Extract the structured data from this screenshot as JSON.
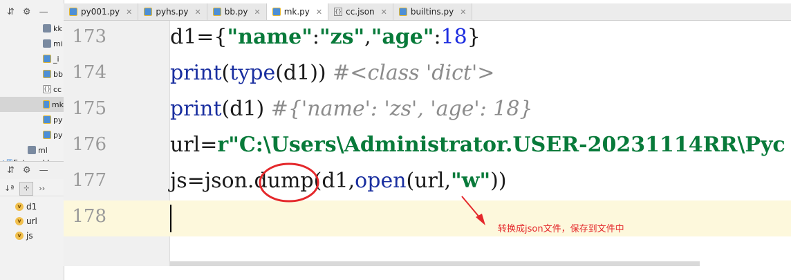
{
  "project_tree": {
    "items": [
      {
        "label": "kk",
        "icon": "folder-icon",
        "selected": false
      },
      {
        "label": "mi",
        "icon": "folder-icon",
        "selected": false
      },
      {
        "label": "_i",
        "icon": "python-file-icon",
        "selected": false
      },
      {
        "label": "bb",
        "icon": "python-file-icon",
        "selected": false
      },
      {
        "label": "cc",
        "icon": "json-file-icon",
        "selected": false
      },
      {
        "label": "mk",
        "icon": "python-file-icon",
        "selected": true
      },
      {
        "label": "py",
        "icon": "python-file-icon",
        "selected": false
      },
      {
        "label": "py",
        "icon": "python-file-icon",
        "selected": false
      },
      {
        "label": "ml",
        "icon": "folder-icon",
        "selected": false
      },
      {
        "label": "External L",
        "icon": "library-icon",
        "selected": false
      }
    ]
  },
  "structure": {
    "items": [
      {
        "label": "d1",
        "badge": "v"
      },
      {
        "label": "url",
        "badge": "v"
      },
      {
        "label": "js",
        "badge": "v"
      }
    ]
  },
  "tabs": [
    {
      "label": "py001.py",
      "icon": "python-file-icon",
      "active": false
    },
    {
      "label": "pyhs.py",
      "icon": "python-file-icon",
      "active": false
    },
    {
      "label": "bb.py",
      "icon": "python-file-icon",
      "active": false
    },
    {
      "label": "mk.py",
      "icon": "python-file-icon",
      "active": true
    },
    {
      "label": "cc.json",
      "icon": "json-file-icon",
      "active": false
    },
    {
      "label": "builtins.py",
      "icon": "python-file-icon",
      "active": false
    }
  ],
  "editor": {
    "lines": [
      {
        "number": "173",
        "tokens": [
          [
            "d1={",
            ""
          ],
          [
            "\"name\"",
            "str"
          ],
          [
            ":",
            ""
          ],
          [
            "\"zs\"",
            "str"
          ],
          [
            ",",
            ""
          ],
          [
            "\"age\"",
            "str"
          ],
          [
            ":",
            ""
          ],
          [
            "18",
            "num"
          ],
          [
            "}",
            ""
          ]
        ]
      },
      {
        "number": "174",
        "tokens": [
          [
            "print",
            "kw"
          ],
          [
            "(",
            ""
          ],
          [
            "type",
            "kw"
          ],
          [
            "(d1)) ",
            ""
          ],
          [
            "#<class 'dict'>",
            "cmt"
          ]
        ]
      },
      {
        "number": "175",
        "tokens": [
          [
            "print",
            "kw"
          ],
          [
            "(d1) ",
            ""
          ],
          [
            "#{'name': 'zs', 'age': 18}",
            "cmt"
          ]
        ]
      },
      {
        "number": "176",
        "tokens": [
          [
            "url=",
            ""
          ],
          [
            "r\"C:\\Users\\Administrator.USER-20231114RR\\Pyc",
            "str"
          ]
        ]
      },
      {
        "number": "177",
        "tokens": [
          [
            "js=json.dump(d1,",
            ""
          ],
          [
            "open",
            "kw"
          ],
          [
            "(url,",
            ""
          ],
          [
            "\"w\"",
            "str"
          ],
          [
            "))",
            ""
          ]
        ]
      },
      {
        "number": "178",
        "tokens": []
      }
    ],
    "current_line": "178"
  },
  "annotation": {
    "text": "转换成json文件，保存到文件中",
    "color": "#e4282b"
  },
  "icons": {
    "settings": "gear-icon",
    "collapse": "collapse-icon",
    "minimize": "minimize-icon",
    "sort": "sort-alpha-icon",
    "show_fields": "field-filter-icon",
    "more": "more-icon"
  },
  "glyphs": {
    "settings": "⚙",
    "collapse": "⇵",
    "minimize": "—",
    "sort": "↓ª",
    "show_fields": "⊹",
    "more": "››",
    "close": "✕",
    "folder": "",
    "variable_badge": "v"
  }
}
